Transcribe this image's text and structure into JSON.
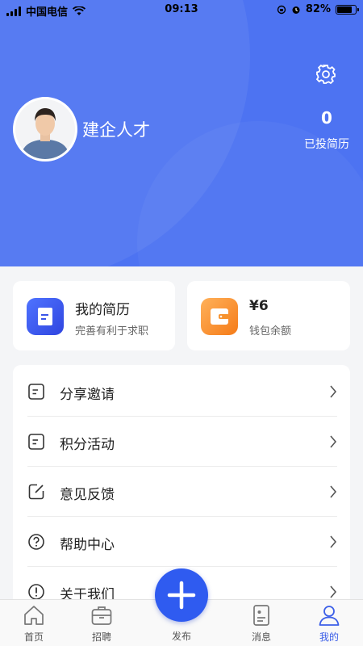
{
  "status_bar": {
    "carrier": "中国电信",
    "time": "09:13",
    "battery": "82%",
    "battery_level": 0.82
  },
  "profile": {
    "username": "建企人才",
    "resume_count": "0",
    "resume_count_label": "已投简历"
  },
  "cards": {
    "resume": {
      "title": "我的简历",
      "subtitle": "完善有利于求职"
    },
    "wallet": {
      "title": "¥6",
      "subtitle": "钱包余额"
    }
  },
  "menu": [
    {
      "label": "分享邀请",
      "icon": "list-icon"
    },
    {
      "label": "积分活动",
      "icon": "list-icon"
    },
    {
      "label": "意见反馈",
      "icon": "edit-icon"
    },
    {
      "label": "帮助中心",
      "icon": "help-icon"
    },
    {
      "label": "关于我们",
      "icon": "info-icon"
    }
  ],
  "tabbar": {
    "home": "首页",
    "jobs": "招聘",
    "publish": "发布",
    "messages": "消息",
    "mine": "我的"
  },
  "colors": {
    "header_blue": "#4d73f2",
    "accent_blue": "#2f5bf0",
    "wallet_orange": "#f57b18"
  }
}
